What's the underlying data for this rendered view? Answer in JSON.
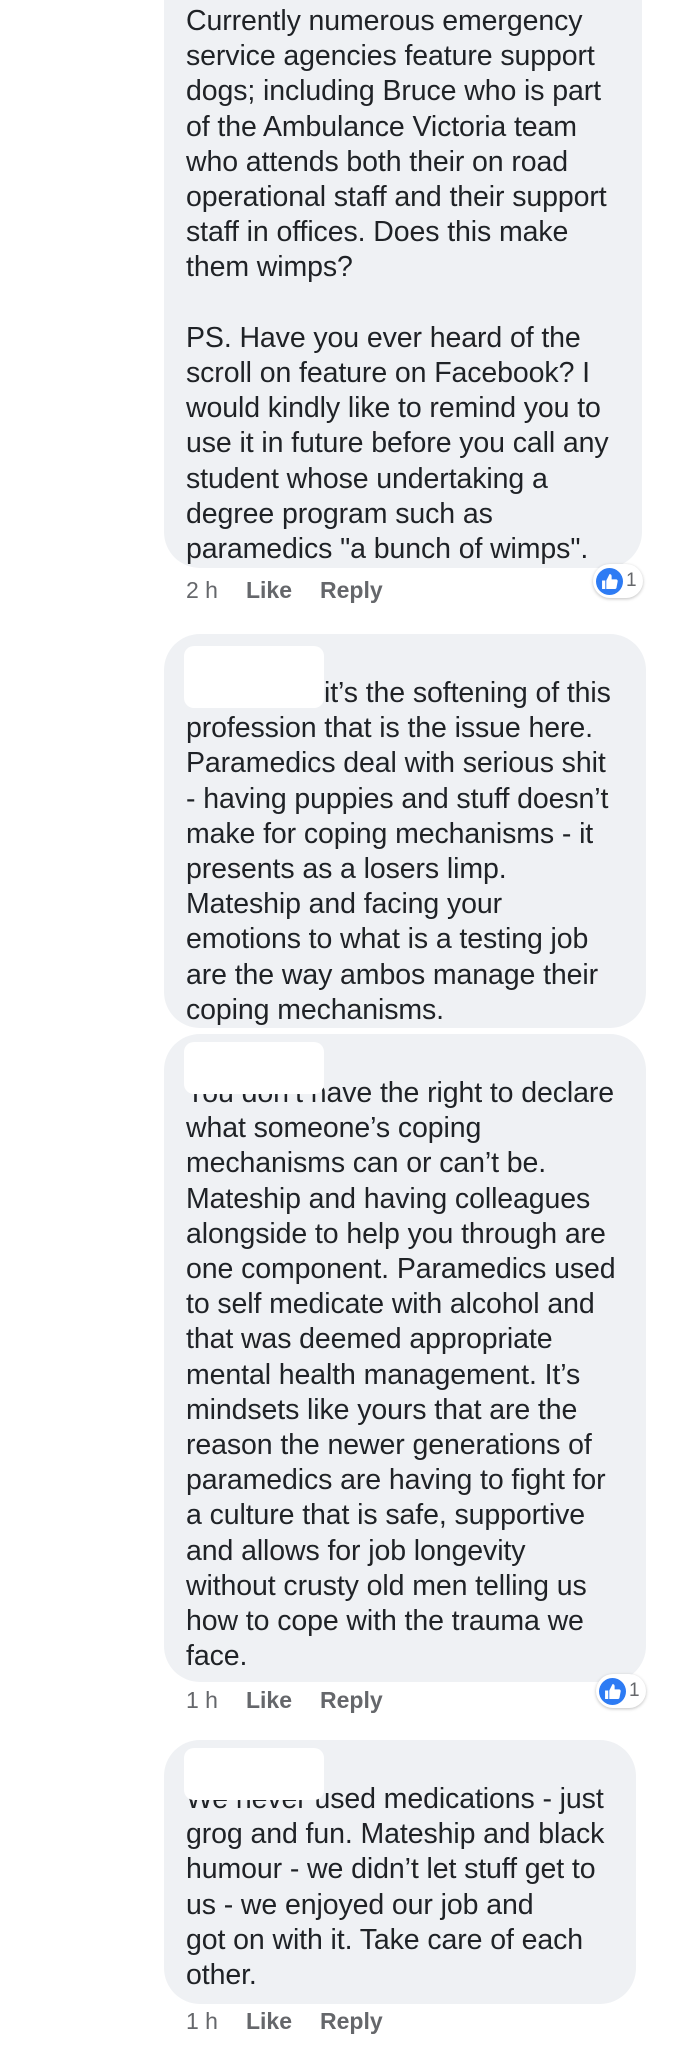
{
  "comments": [
    {
      "text": "Currently numerous emergency\nservice agencies feature support\ndogs; including Bruce who is part\nof the Ambulance Victoria team\nwho attends both their on road\noperational staff and their support\nstaff in offices. Does this make\nthem wimps?\n\nPS. Have you ever heard of the\nscroll on feature on Facebook? I\nwould kindly like to remind you to\nuse it in future before you call any\nstudent whose undertaking a\ndegree program such as\nparamedics \"a bunch of wimps\".",
      "time": "2 h",
      "like_label": "Like",
      "reply_label": "Reply",
      "reaction_count": "1"
    },
    {
      "text": "it’s the softening of this\nprofession that is the issue here.\nParamedics deal with serious shit\n- having puppies and stuff doesn’t\nmake for coping mechanisms - it\npresents as a losers limp.\nMateship and facing your\nemotions to what is a testing job\nare the way ambos manage their\ncoping mechanisms."
    },
    {
      "text": "You don’t have the right to declare\nwhat someone’s coping\nmechanisms can or can’t be.\nMateship and having colleagues\nalongside to help you through are\none component. Paramedics used\nto self medicate with alcohol and\nthat was deemed appropriate\nmental health management. It’s\nmindsets like yours that are the\nreason the newer generations of\nparamedics are having to fight for\na culture that is safe, supportive\nand allows for job longevity\nwithout crusty old men telling us\nhow to cope with the trauma we\nface.",
      "time": "1 h",
      "like_label": "Like",
      "reply_label": "Reply",
      "reaction_count": "1"
    },
    {
      "text": "We never used medications - just\ngrog and fun. Mateship and black\nhumour - we didn’t let stuff get to\nus - we enjoyed our job and\n got on with it. Take care of each\nother.",
      "time": "1 h",
      "like_label": "Like",
      "reply_label": "Reply"
    }
  ],
  "colors": {
    "bubble": "#eff1f4",
    "text": "#1f2226",
    "meta": "#65676b",
    "like_reaction": "#2d7bf4"
  },
  "icons": [
    "like-reaction-icon"
  ]
}
